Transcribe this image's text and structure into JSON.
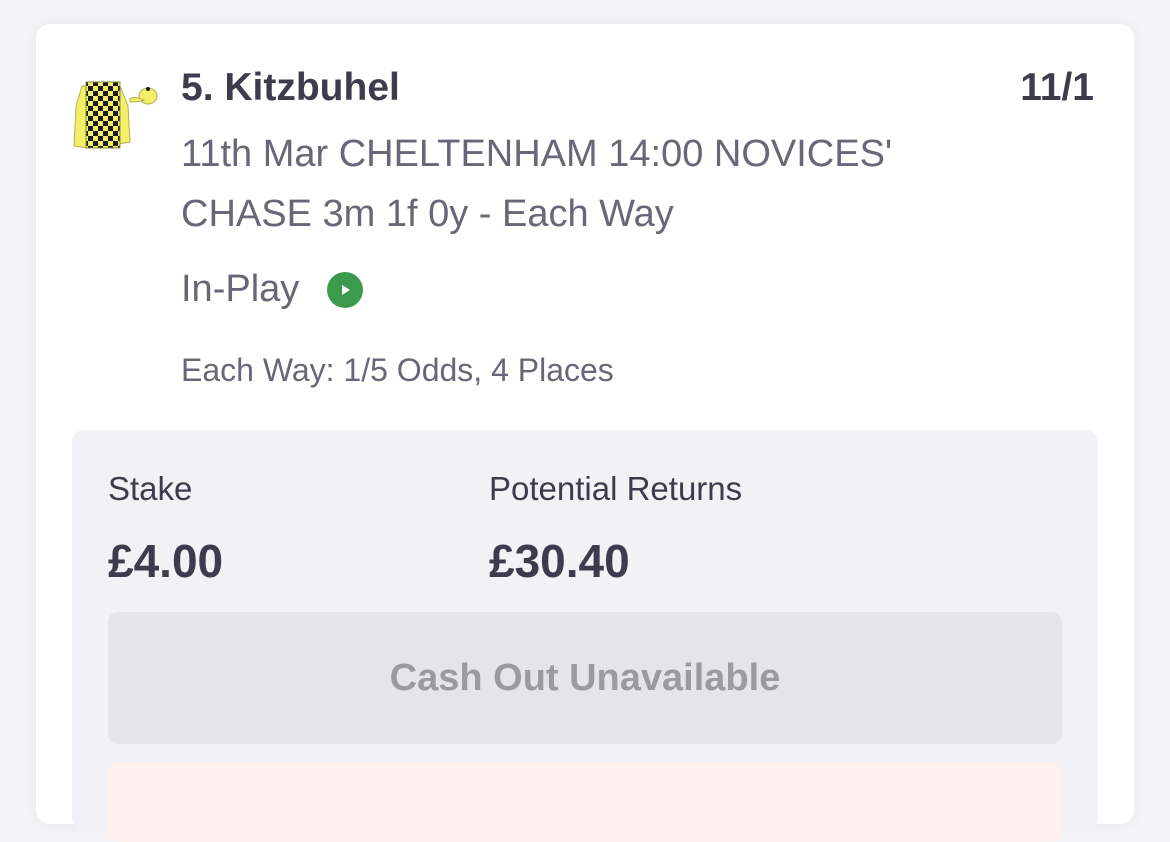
{
  "selection": {
    "runner": "5. Kitzbuhel",
    "odds": "11/1",
    "event": "11th Mar CHELTENHAM 14:00 NOVICES' CHASE 3m 1f 0y - Each Way",
    "status": "In-Play",
    "status_icon": "play-icon",
    "each_way_terms": "Each Way: 1/5 Odds, 4 Places",
    "silks_colors": {
      "body": "#f3ef6a",
      "check": "#1c1c1c",
      "cap": "#f3ef6a"
    }
  },
  "bet": {
    "stake_label": "Stake",
    "stake_value": "£4.00",
    "returns_label": "Potential Returns",
    "returns_value": "£30.40",
    "cashout_label": "Cash Out Unavailable"
  },
  "colors": {
    "text_primary": "#3d3c4c",
    "text_secondary": "#676777",
    "inplay_green": "#3c9a4c",
    "panel_bg": "#f1f1f6",
    "notice_bg": "#fdf1ed"
  }
}
